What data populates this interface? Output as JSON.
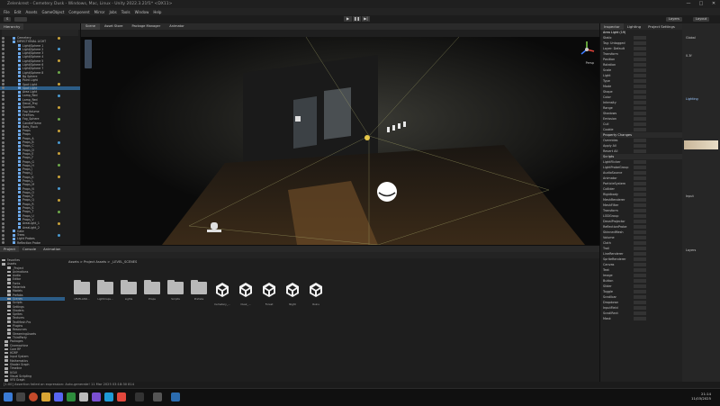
{
  "window": {
    "title": "Zelenkrest - Cemetery Dusk - Windows, Mac, Linux - Unity 2022.3.21f1* <DX11>",
    "controls": [
      "—",
      "□",
      "✕"
    ]
  },
  "menubar": [
    "File",
    "Edit",
    "Assets",
    "GameObject",
    "Component",
    "Mirror",
    "Jobs",
    "Tools",
    "Window",
    "Help"
  ],
  "toolbar": {
    "account": "S",
    "layers": "Layers",
    "layout": "Layout"
  },
  "hierarchy": {
    "tabs": [
      "Hierarchy"
    ],
    "rows": [
      "Cemetery",
      "DIRECTIONAL LIGHT",
      "Light/Sphere 1",
      "Light/Sphere 2",
      "Light/Sphere 3",
      "Light/Sphere 4",
      "Light/Sphere 5",
      "Light/Sphere 6",
      "Light/Sphere 7",
      "Light/Sphere 8",
      "Bg Sphere",
      "Point Light",
      "Spot Light",
      "Spot Light",
      "Area Light",
      "Lamp_Red",
      "Lamp_Red",
      "Decal_Proj",
      "Sparkles",
      "Fog Volume",
      "FireFlies",
      "Fog_Sphere",
      "CandleFlame",
      "Bats_Flock",
      "Props",
      "Props",
      "Props_A",
      "Props_B",
      "Props_C",
      "Props_D",
      "Props_E",
      "Props_F",
      "Props_G",
      "Props_H",
      "Props_I",
      "Props_J",
      "Props_K",
      "Props_L",
      "Props_M",
      "Props_N",
      "Props_O",
      "Props_P",
      "Props_Q",
      "Props_R",
      "Props_S",
      "Props_T",
      "Props_U",
      "Props_V",
      "AreaLight_1",
      "AreaLight_2",
      "Gate",
      "Trees",
      "Light Probes",
      "Reflection Probe",
      "Volume",
      "Audio Zone",
      "Camera",
      "Main Camera"
    ]
  },
  "scene": {
    "tabs": [
      "Scene",
      "Asset Store",
      "Package Manager",
      "Animator"
    ],
    "active_tab": "Scene",
    "gizmo_label": "Persp"
  },
  "inspector": {
    "tabs": [
      "Inspector",
      "Lighting",
      "Project Settings"
    ],
    "object_name": "Area Light (19)",
    "rows": [
      "Static",
      "Tag: Untagged",
      "Layer: Default",
      "Transform",
      "Position",
      "Rotation",
      "Scale",
      "Light",
      "Type",
      "Mode",
      "Shape",
      "Color",
      "Intensity",
      "Range",
      "Shadows",
      "Emission",
      "Cull",
      "Cookie"
    ],
    "section_title": "Property Changes",
    "section_rows": [
      "Overrides",
      "Apply All",
      "Revert All"
    ],
    "components_title": "Scripts",
    "script_rows": [
      "LightFlicker",
      "LightProbeGroup",
      "AudioSource",
      "Animator",
      "ParticleSystem",
      "Collider",
      "Rigidbody",
      "MeshRenderer",
      "MeshFilter",
      "Transform",
      "LODGroup",
      "DecalProjector",
      "ReflectionProbe",
      "SkinnedMesh",
      "Volume",
      "Cloth",
      "Trail",
      "LineRenderer",
      "SpriteRenderer",
      "Canvas",
      "Text",
      "Image",
      "Button",
      "Slider",
      "Toggle",
      "Scrollbar",
      "Dropdown",
      "InputField",
      "ScrollRect",
      "Mask",
      "Outline",
      "Shadow",
      "Layout",
      "Grid",
      "Content",
      "EventSystem",
      "Raycaster",
      "AudioListener",
      "Camera",
      "Skybox",
      "Terrain",
      "Wind",
      "Tree",
      "Navmesh",
      "Agent",
      "Obstacle",
      "Link"
    ],
    "right_labels": [
      "Global",
      "0.3f",
      "Lighting",
      "Input",
      "Layers"
    ]
  },
  "project": {
    "tabs": [
      "Project",
      "Console",
      "Animation"
    ],
    "breadcrumb": "Assets > Project Assets > _LEVEL_SCENES",
    "tree": [
      "Favorites",
      "Assets",
      "_Project",
      "Animations",
      "Audio",
      "Editor",
      "Fonts",
      "Materials",
      "Models",
      "Prefabs",
      "Scenes",
      "Scripts",
      "Settings",
      "Shaders",
      "Sprites",
      "Textures",
      "TextMesh Pro",
      "Plugins",
      "Resources",
      "StreamingAssets",
      "ThirdParty",
      "Packages",
      "Cinemachine",
      "Core RP",
      "HDRP",
      "Input System",
      "Mathematics",
      "Shader Graph",
      "Timeline",
      "UGUI",
      "Visual Scripting",
      "VFX Graph",
      "Build",
      "Tests",
      "Docs"
    ],
    "assets": [
      {
        "type": "folder",
        "label": "LEVELASSI..."
      },
      {
        "type": "folder",
        "label": "Lightmaps..."
      },
      {
        "type": "folder",
        "label": "Lights"
      },
      {
        "type": "folder",
        "label": "Props"
      },
      {
        "type": "folder",
        "label": "Scripts"
      },
      {
        "type": "folder",
        "label": "Prefabs"
      },
      {
        "type": "unity",
        "label": "Cemetery_..."
      },
      {
        "type": "unity",
        "label": "Dusk_..."
      },
      {
        "type": "unity",
        "label": "Forest"
      },
      {
        "type": "unity",
        "label": "Night"
      },
      {
        "type": "unity",
        "label": "Ruins"
      }
    ]
  },
  "statusbar": "[1:00] Assertion failed on expression: Auto-generate! 11 Mar 2025 03:18:30 814",
  "taskbar": {
    "clock_time": "21:14",
    "clock_date": "11/03/2025"
  },
  "colors": {
    "accent": "#2c5d87",
    "unity_blue": "#6da8e8",
    "warning": "#d68a2f"
  }
}
